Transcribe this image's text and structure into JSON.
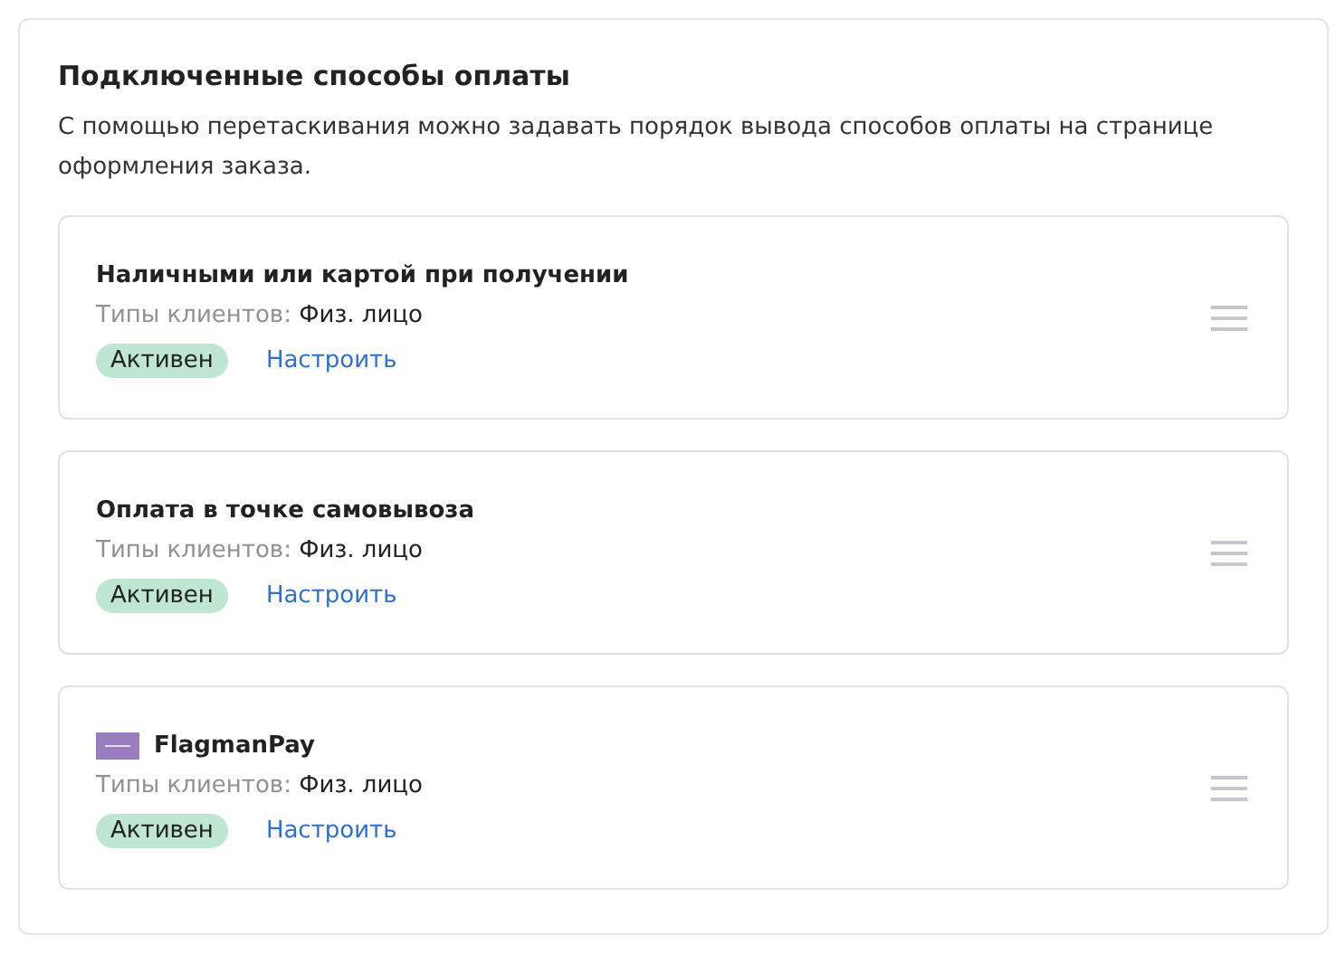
{
  "panel": {
    "title": "Подключенные способы оплаты",
    "description": "С помощью перетаскивания можно задавать порядок вывода способов оплаты на странице оформления заказа."
  },
  "methods": [
    {
      "name": "Наличными или картой при получении",
      "logo": false,
      "clients_label": "Типы клиентов:",
      "clients": "Физ. лицо",
      "status": "Активен",
      "action": "Настроить"
    },
    {
      "name": "Оплата в точке самовывоза",
      "logo": false,
      "clients_label": "Типы клиентов:",
      "clients": "Физ. лицо",
      "status": "Активен",
      "action": "Настроить"
    },
    {
      "name": "FlagmanPay",
      "logo": true,
      "clients_label": "Типы клиентов:",
      "clients": "Физ. лицо",
      "status": "Активен",
      "action": "Настроить"
    }
  ]
}
